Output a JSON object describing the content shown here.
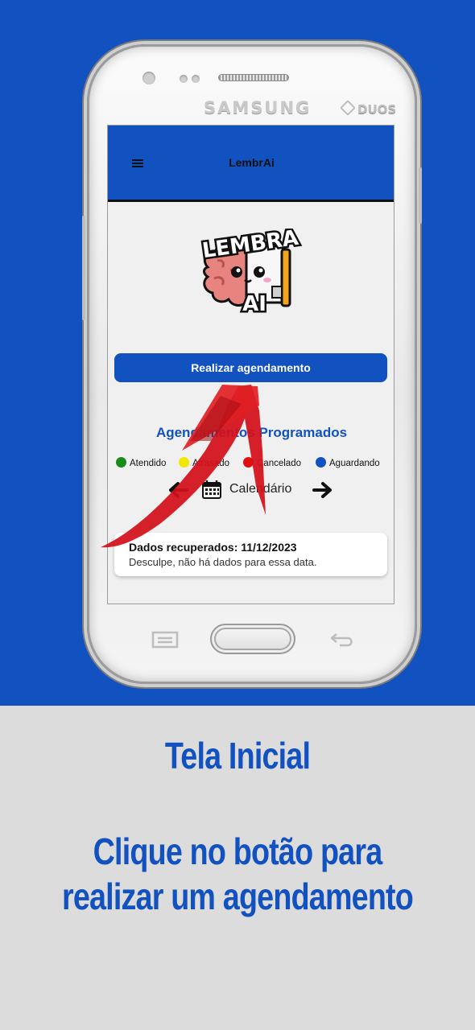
{
  "colors": {
    "brand_blue": "#1151c0",
    "page_bg": "#dcdcdc",
    "attended": "#1a8a1a",
    "delayed": "#f2e600",
    "cancelled": "#e01010",
    "waiting": "#1151c0"
  },
  "phone": {
    "brand": "SAMSUNG",
    "model": "DUOS"
  },
  "app": {
    "title": "LembrAi",
    "menu_icon": "hamburger-menu-icon",
    "logo": {
      "line1": "LEMBRA",
      "line2": "AI"
    },
    "primary_button": "Realizar agendamento",
    "section_title": "Agendamentos Programados",
    "legend": [
      {
        "label": "Atendido",
        "color": "#1a8a1a"
      },
      {
        "label": "Atrasado",
        "color": "#f2e600"
      },
      {
        "label": "Cancelado",
        "color": "#e01010"
      },
      {
        "label": "Aguardando",
        "color": "#1151c0"
      }
    ],
    "calendar": {
      "label": "Calendário",
      "prev_icon": "arrow-left-icon",
      "next_icon": "arrow-right-icon",
      "calendar_icon": "calendar-icon"
    },
    "card": {
      "title": "Dados recuperados: 11/12/2023",
      "message": "Desculpe, não há dados para essa data."
    }
  },
  "caption": {
    "heading": "Tela Inicial",
    "line1": "Clique no botão para",
    "line2": "realizar um agendamento"
  }
}
